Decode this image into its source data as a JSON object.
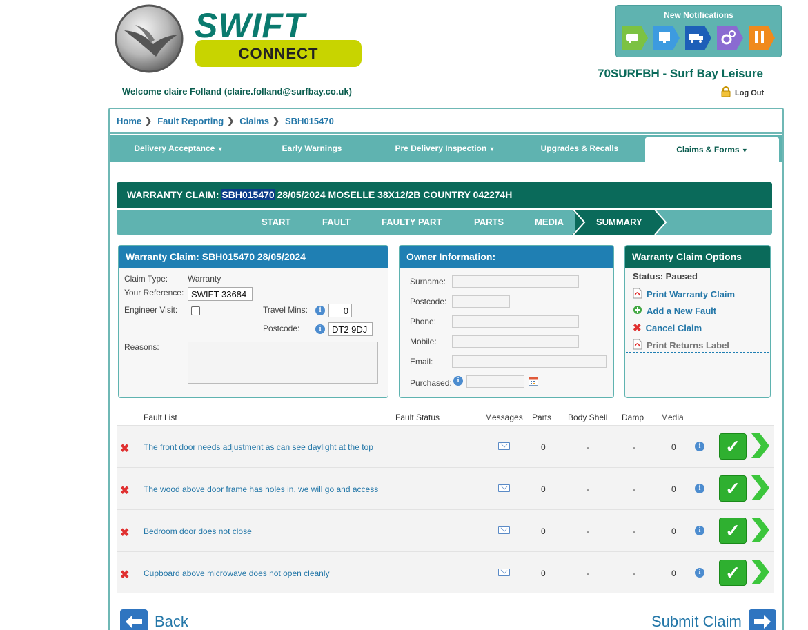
{
  "brand": {
    "name": "SWIFT",
    "sub": "CONNECT"
  },
  "welcome": "Welcome claire Folland (claire.folland@surfbay.co.uk)",
  "notifications": {
    "title": "New Notifications",
    "icons": [
      "caravan-icon",
      "monitor-icon",
      "truck-icon",
      "gears-icon",
      "tools-icon"
    ]
  },
  "dealer": "70SURFBH - Surf Bay Leisure",
  "logout": "Log Out",
  "breadcrumb": [
    "Home",
    "Fault Reporting",
    "Claims",
    "SBH015470"
  ],
  "nav": [
    {
      "label": "Delivery Acceptance",
      "dropdown": true
    },
    {
      "label": "Early Warnings",
      "dropdown": false
    },
    {
      "label": "Pre Delivery Inspection",
      "dropdown": true
    },
    {
      "label": "Upgrades & Recalls",
      "dropdown": false
    },
    {
      "label": "Claims & Forms",
      "dropdown": true
    }
  ],
  "claim_header": {
    "prefix": "WARRANTY CLAIM:",
    "claim_id": "SBH015470",
    "rest": "28/05/2024 MOSELLE 38X12/2B COUNTRY 042274H"
  },
  "steps": [
    "START",
    "FAULT",
    "FAULTY PART",
    "PARTS",
    "MEDIA",
    "SUMMARY"
  ],
  "claim_panel": {
    "title": "Warranty Claim: SBH015470 28/05/2024",
    "claim_type_label": "Claim Type:",
    "claim_type": "Warranty",
    "your_ref_label": "Your Reference:",
    "your_ref": "SWIFT-33684",
    "engineer_label": "Engineer Visit:",
    "travel_label": "Travel Mins:",
    "travel_value": "0",
    "postcode_label": "Postcode:",
    "postcode_value": "DT2 9DJ",
    "reasons_label": "Reasons:"
  },
  "owner_panel": {
    "title": "Owner Information:",
    "fields": [
      "Surname:",
      "Postcode:",
      "Phone:",
      "Mobile:",
      "Email:",
      "Purchased:"
    ]
  },
  "options_panel": {
    "title": "Warranty Claim Options",
    "status": "Status: Paused",
    "print_claim": "Print Warranty Claim",
    "add_fault": "Add a New Fault",
    "cancel": "Cancel Claim",
    "print_returns": "Print Returns Label"
  },
  "fault_table": {
    "headers": [
      "Fault List",
      "Fault Status",
      "Messages",
      "Parts",
      "Body Shell",
      "Damp",
      "Media"
    ],
    "rows": [
      {
        "desc": "The front door needs adjustment as can see daylight at the top",
        "parts": "0",
        "body": "-",
        "damp": "-",
        "media": "0"
      },
      {
        "desc": "The wood above door frame has holes in, we will go and access",
        "parts": "0",
        "body": "-",
        "damp": "-",
        "media": "0"
      },
      {
        "desc": "Bedroom door does not close",
        "parts": "0",
        "body": "-",
        "damp": "-",
        "media": "0"
      },
      {
        "desc": "Cupboard above microwave does not open cleanly",
        "parts": "0",
        "body": "-",
        "damp": "-",
        "media": "0"
      }
    ]
  },
  "buttons": {
    "back": "Back",
    "submit": "Submit Claim"
  },
  "colors": {
    "teal": "#5fb3b0",
    "dark_green": "#0a6a5a",
    "blue": "#1f7fb3",
    "lime": "#c8d400"
  }
}
